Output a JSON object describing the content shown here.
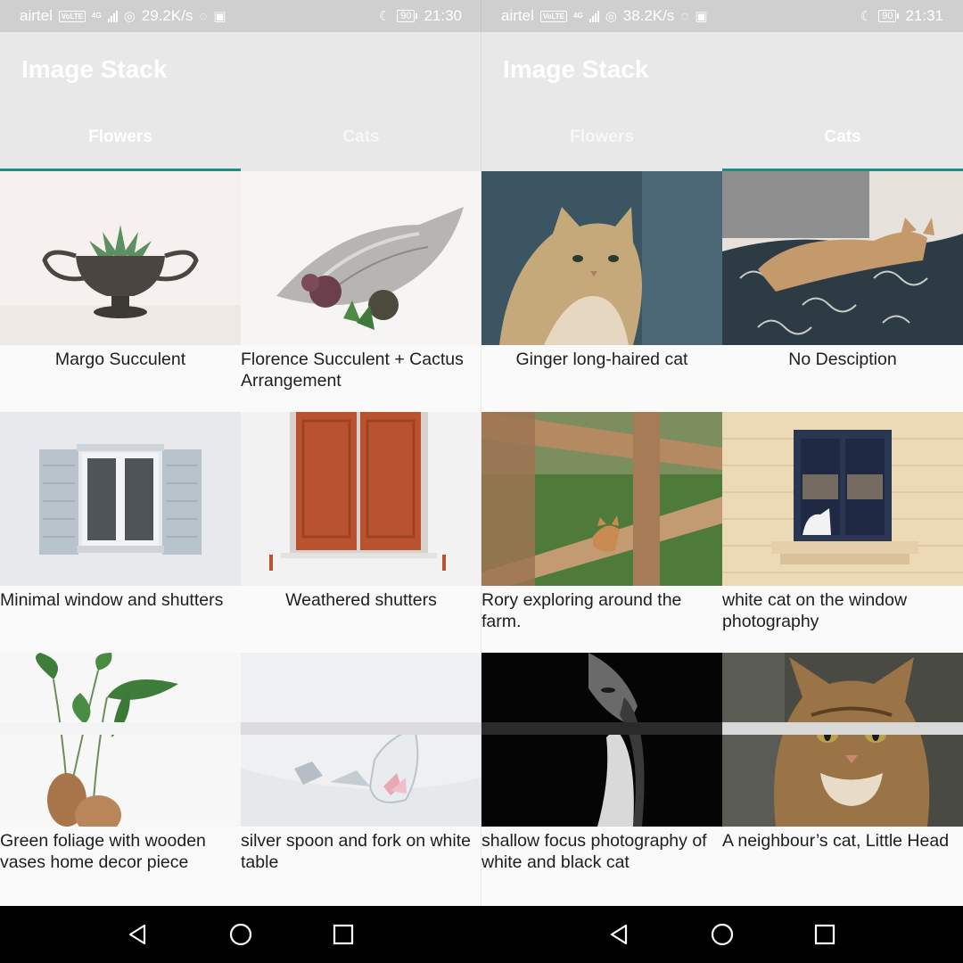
{
  "screens": [
    {
      "status": {
        "carrier": "airtel",
        "volte": "VoLTE",
        "network": "4G",
        "speed": "29.2K/s",
        "battery": "90",
        "time": "21:30"
      },
      "app_title": "Image Stack",
      "tabs": [
        {
          "label": "Flowers",
          "active": true
        },
        {
          "label": "Cats",
          "active": false
        }
      ],
      "items": [
        {
          "caption": "Margo Succulent"
        },
        {
          "caption": "Florence Succulent + Cactus Arrangement"
        },
        {
          "caption": "Minimal window and shutters"
        },
        {
          "caption": "Weathered shutters"
        },
        {
          "caption": "Green foliage with wooden vases home decor piece"
        },
        {
          "caption": "silver spoon and fork on white table"
        }
      ]
    },
    {
      "status": {
        "carrier": "airtel",
        "volte": "VoLTE",
        "network": "4G",
        "speed": "38.2K/s",
        "battery": "90",
        "time": "21:31"
      },
      "app_title": "Image Stack",
      "tabs": [
        {
          "label": "Flowers",
          "active": false
        },
        {
          "label": "Cats",
          "active": true
        }
      ],
      "items": [
        {
          "caption": "Ginger long-haired cat"
        },
        {
          "caption": "No Desciption"
        },
        {
          "caption": "Rory exploring around the farm."
        },
        {
          "caption": "white cat on the window photography"
        },
        {
          "caption": "shallow focus photography of white and black cat"
        },
        {
          "caption": "A neighbour’s cat, Little Head"
        }
      ]
    }
  ],
  "icons": {
    "status": [
      "signal-icon",
      "hotspot-icon",
      "whatsapp-icon",
      "instagram-icon",
      "moon-icon",
      "battery-icon"
    ],
    "nav": [
      "back-icon",
      "home-icon",
      "recents-icon"
    ]
  },
  "colors": {
    "accent": "#1b8f86",
    "appbar": "#e8e8e8",
    "statusbar": "#cfcfcf",
    "navbar": "#000000"
  }
}
